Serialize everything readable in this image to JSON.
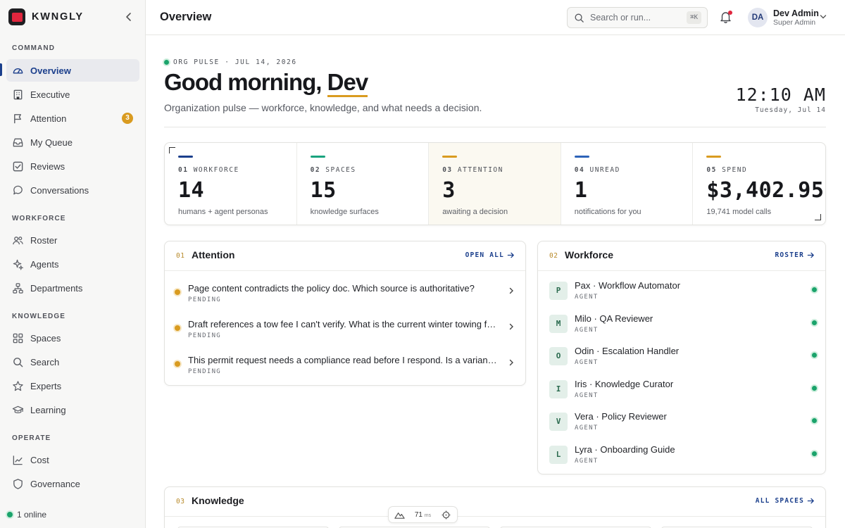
{
  "brand": {
    "name": "KWNGLY"
  },
  "sidebar": {
    "sections": [
      {
        "label": "COMMAND",
        "items": [
          {
            "label": "Overview",
            "icon": "gauge-icon",
            "active": true
          },
          {
            "label": "Executive",
            "icon": "building-icon"
          },
          {
            "label": "Attention",
            "icon": "flag-icon",
            "badge": "3"
          },
          {
            "label": "My Queue",
            "icon": "inbox-icon"
          },
          {
            "label": "Reviews",
            "icon": "checkbox-icon"
          },
          {
            "label": "Conversations",
            "icon": "chat-icon"
          }
        ]
      },
      {
        "label": "WORKFORCE",
        "items": [
          {
            "label": "Roster",
            "icon": "users-icon"
          },
          {
            "label": "Agents",
            "icon": "sparkles-icon"
          },
          {
            "label": "Departments",
            "icon": "network-icon"
          }
        ]
      },
      {
        "label": "KNOWLEDGE",
        "items": [
          {
            "label": "Spaces",
            "icon": "grid-icon"
          },
          {
            "label": "Search",
            "icon": "search-icon"
          },
          {
            "label": "Experts",
            "icon": "star-icon"
          },
          {
            "label": "Learning",
            "icon": "graduation-cap-icon"
          }
        ]
      },
      {
        "label": "OPERATE",
        "items": [
          {
            "label": "Cost",
            "icon": "trend-icon"
          },
          {
            "label": "Governance",
            "icon": "shield-icon"
          }
        ]
      }
    ],
    "online": "1 online"
  },
  "topbar": {
    "title": "Overview",
    "search_placeholder": "Search or run...",
    "search_shortcut": "⌘K",
    "user": {
      "initials": "DA",
      "name": "Dev Admin",
      "role": "Super Admin"
    }
  },
  "hero": {
    "pulse": "ORG PULSE · JUL 14, 2026",
    "greeting_prefix": "Good morning, ",
    "greeting_name": "Dev",
    "subtitle": "Organization pulse — workforce, knowledge, and what needs a decision.",
    "time": "12:10 AM",
    "date": "Tuesday, Jul 14"
  },
  "stats": [
    {
      "num": "01",
      "label": "WORKFORCE",
      "value": "14",
      "note": "humans + agent personas",
      "color": "#1b3f8c"
    },
    {
      "num": "02",
      "label": "SPACES",
      "value": "15",
      "note": "knowledge surfaces",
      "color": "#1aa37e"
    },
    {
      "num": "03",
      "label": "ATTENTION",
      "value": "3",
      "note": "awaiting a decision",
      "color": "#d99b20",
      "highlight": true
    },
    {
      "num": "04",
      "label": "UNREAD",
      "value": "1",
      "note": "notifications for you",
      "color": "#2d63b8"
    },
    {
      "num": "05",
      "label": "SPEND",
      "value": "$3,402.95",
      "note": "19,741 model calls",
      "color": "#d99b20"
    }
  ],
  "attention": {
    "num": "01",
    "title": "Attention",
    "link": "OPEN ALL",
    "items": [
      {
        "question": "Page content contradicts the policy doc. Which source is authoritative?",
        "status": "PENDING"
      },
      {
        "question": "Draft references a tow fee I can't verify. What is the current winter towing fee?",
        "status": "PENDING"
      },
      {
        "question": "This permit request needs a compliance read before I respond. Is a variance required?",
        "status": "PENDING"
      }
    ]
  },
  "workforce": {
    "num": "02",
    "title": "Workforce",
    "link": "ROSTER",
    "items": [
      {
        "initial": "P",
        "name": "Pax · Workflow Automator",
        "role": "AGENT"
      },
      {
        "initial": "M",
        "name": "Milo · QA Reviewer",
        "role": "AGENT"
      },
      {
        "initial": "O",
        "name": "Odin · Escalation Handler",
        "role": "AGENT"
      },
      {
        "initial": "I",
        "name": "Iris · Knowledge Curator",
        "role": "AGENT"
      },
      {
        "initial": "V",
        "name": "Vera · Policy Reviewer",
        "role": "AGENT"
      },
      {
        "initial": "L",
        "name": "Lyra · Onboarding Guide",
        "role": "AGENT"
      }
    ]
  },
  "knowledge": {
    "num": "03",
    "title": "Knowledge",
    "link": "ALL SPACES"
  },
  "perf": {
    "value": "71",
    "unit": "ms"
  }
}
